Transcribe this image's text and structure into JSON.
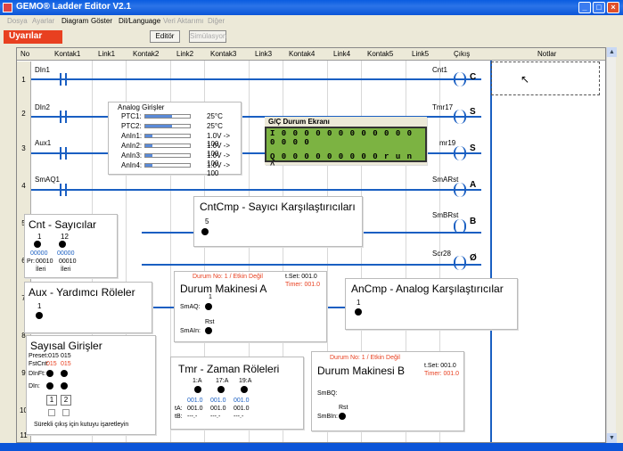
{
  "window": {
    "title": "GEMO® Ladder Editor V2.1"
  },
  "menu": {
    "items": [
      "Dosya",
      "Ayarlar",
      "Diagram",
      "Göster",
      "Dil/Language",
      "Veri Aktarımı",
      "Diğer"
    ]
  },
  "toolbar": {
    "alarm": "Uyarılar",
    "editor": "Editör",
    "sim": "Simülasyon"
  },
  "header": {
    "no": "No",
    "cols": [
      "Kontak1",
      "Link1",
      "Kontak2",
      "Link2",
      "Kontak3",
      "Link3",
      "Kontak4",
      "Link4",
      "Kontak5",
      "Link5",
      "Çıkış",
      "Notlar"
    ]
  },
  "rows": [
    "1",
    "2",
    "3",
    "4",
    "5",
    "6",
    "7",
    "8",
    "9",
    "10",
    "11"
  ],
  "contacts": {
    "r1": "DIn1",
    "r2": "DIn2",
    "r3": "Aux1",
    "r4": "SmAQ1"
  },
  "coils": {
    "c1": "Cnt1",
    "c2": "Tmr17",
    "c3": "mr19",
    "c4": "SmARst",
    "c5": "SmBRst",
    "c6": "Scr28"
  },
  "coil_icons": {
    "c1": "C",
    "c2": "S",
    "c3": "S",
    "c4": "A",
    "c5": "B",
    "c6": "Ø"
  },
  "analog": {
    "title": "Analog Girişler",
    "rows": [
      {
        "n": "PTC1:",
        "v": "25°C"
      },
      {
        "n": "PTC2:",
        "v": "25°C"
      },
      {
        "n": "AnIn1:",
        "v": "1.0V -> 100"
      },
      {
        "n": "AnIn2:",
        "v": "1.0V -> 100"
      },
      {
        "n": "AnIn3:",
        "v": "1.0V -> 100"
      },
      {
        "n": "AnIn4:",
        "v": "1.0V -> 100"
      }
    ]
  },
  "io": {
    "title": "G/Ç Durum Ekranı",
    "line1": "I 0 0 0 0 0 0 0 0 0 0 0 0 0 0 0 0",
    "line2": "Q 0 0 0 0 0 0 0 0 0 r u n ^"
  },
  "cnt": {
    "title": "Cnt - Sayıcılar",
    "n1": "1",
    "n2": "12",
    "b1": "00000",
    "b2": "00000",
    "pr": "Pr:",
    "p1": "00010",
    "p2": "00010",
    "i1": "İleri",
    "i2": "İleri"
  },
  "cntcmp": {
    "title": "CntCmp - Sayıcı Karşılaştırıcıları",
    "n": "5"
  },
  "aux": {
    "title": "Aux - Yardımcı Röleler",
    "n": "1"
  },
  "sma": {
    "status": "Durum No: 1 / Etkin Değil",
    "title": "Durum Makinesi A",
    "tset": "t.Set: 001.0",
    "timer": "Timer: 001.0",
    "n": "1",
    "aq": "SmAQ:",
    "rst": "Rst",
    "ain": "SmAIn:"
  },
  "ancmp": {
    "title": "AnCmp - Analog Karşılaştırıcılar",
    "n": "1"
  },
  "dig": {
    "title": "Sayısal Girişler",
    "preset": "Preset:015",
    "p2": "015",
    "fst": "FstCnt:",
    "f1": "015",
    "f2": "015",
    "dinf": "DInFt:",
    "din": "DIn:",
    "b1": "1",
    "b2": "2",
    "note": "Sürekli çıkış için kutuyu işaretleyin"
  },
  "tmr": {
    "title": "Tmr - Zaman Röleleri",
    "h1": "1:A",
    "h2": "17:A",
    "h3": "19:A",
    "v": "001.0",
    "ta": "tA:",
    "tb": "tB:",
    "tav": "001.0",
    "tbv": "---.-"
  },
  "smb": {
    "status": "Durum No: 1 / Etkin Değil",
    "title": "Durum Makinesi B",
    "tset": "t.Set: 001.0",
    "timer": "Timer: 001.0",
    "bq": "SmBQ:",
    "rst": "Rst",
    "bin": "SmBIn:"
  }
}
